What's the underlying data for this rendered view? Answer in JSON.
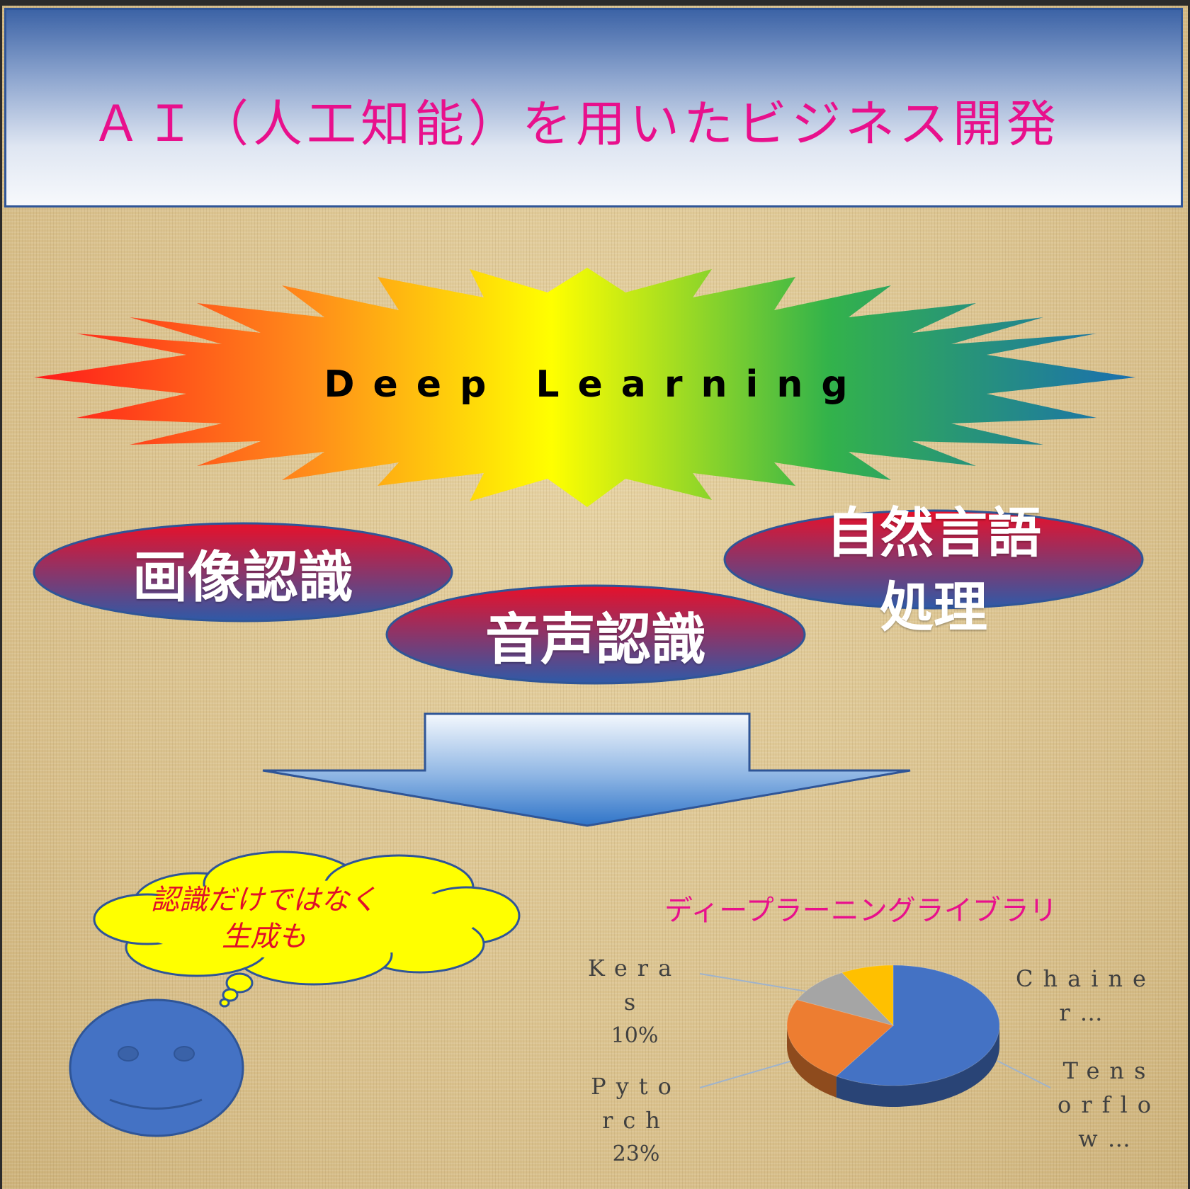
{
  "title": "ＡＩ（人工知能）を用いたビジネス開発",
  "burst_label": "Deep Learning",
  "categories": [
    {
      "label": "画像認識"
    },
    {
      "label": "音声認識"
    },
    {
      "label": "自然言語\n処理"
    }
  ],
  "thought_bubble": "認識だけではなく\n生成も",
  "colors": {
    "title_text": "#e8108c",
    "pill_top": "#e8102a",
    "pill_bottom": "#2e5aa8",
    "thought_fill": "#ffff00",
    "face": "#4472c4"
  },
  "chart_data": {
    "type": "pie",
    "title": "ディープラーニングライブラリ",
    "slices": [
      {
        "name": "Tensorflow",
        "value": 59,
        "color": "#4472c4",
        "label": "Tensorflow..."
      },
      {
        "name": "Pytorch",
        "value": 23,
        "color": "#ed7d31",
        "label": "Pytorch\n23%"
      },
      {
        "name": "Keras",
        "value": 10,
        "color": "#a5a5a5",
        "label": "Keras\n10%"
      },
      {
        "name": "Chainer",
        "value": 8,
        "color": "#ffc000",
        "label": "Chainer..."
      }
    ],
    "labels": {
      "keras_name": "Keras",
      "keras_pct": "10%",
      "pytorch_name": "Pytorch",
      "pytorch_pct": "23%",
      "chainer_name": "Chainer…",
      "tensorflow_name": "Tensorflow…"
    }
  }
}
